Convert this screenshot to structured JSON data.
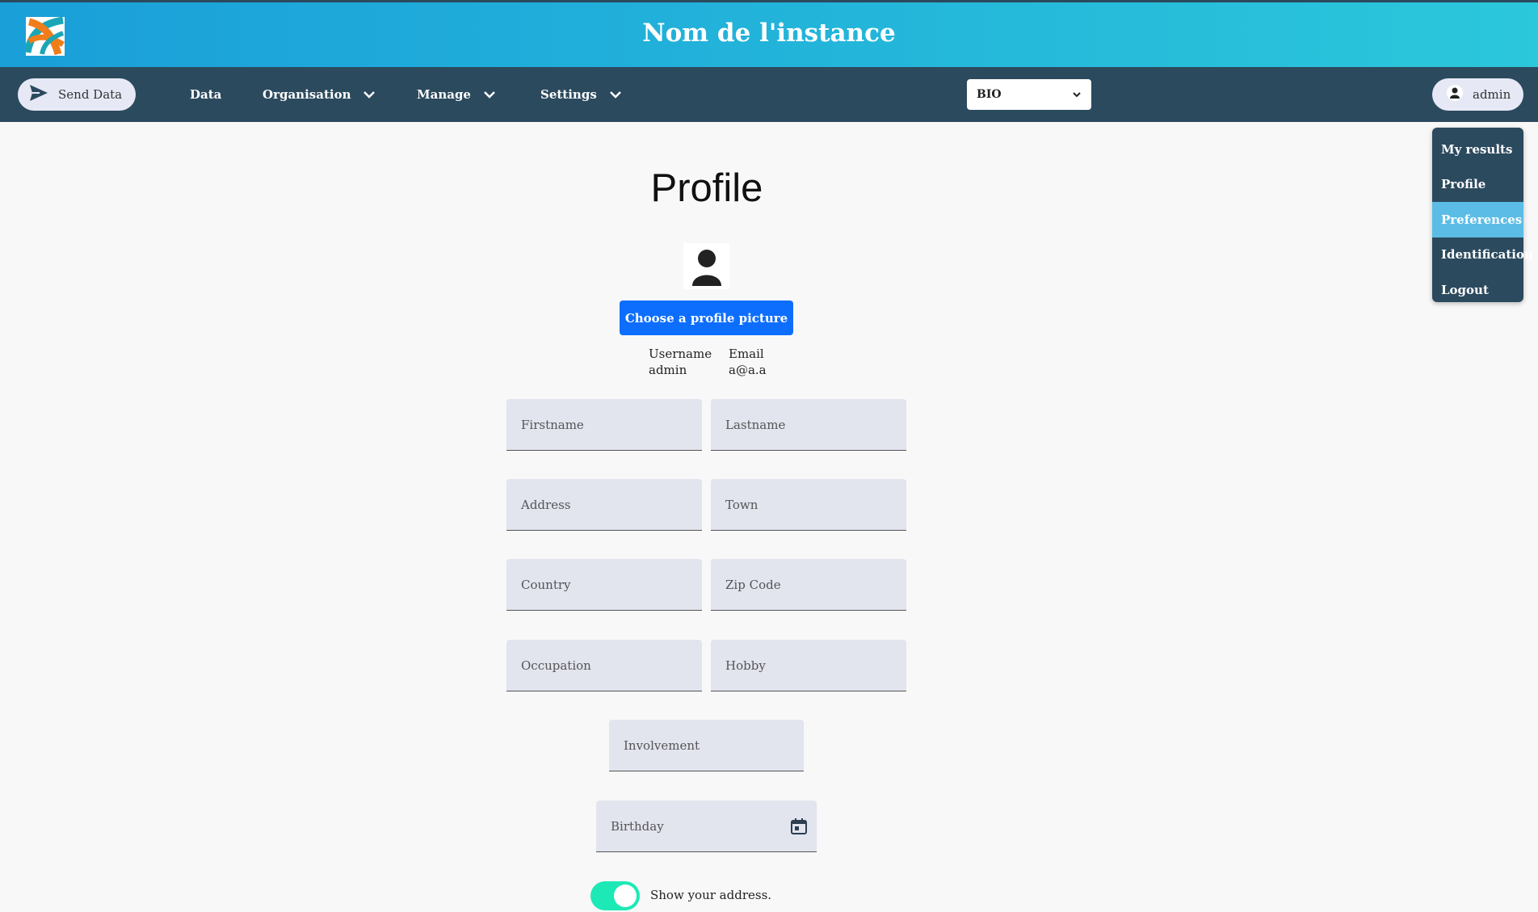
{
  "header": {
    "title": "Nom de l'instance",
    "logo_icon": "logo-icon"
  },
  "nav": {
    "send_label": "Send Data",
    "items": [
      {
        "label": "Data"
      },
      {
        "label": "Organisation"
      },
      {
        "label": "Manage"
      },
      {
        "label": "Settings"
      }
    ],
    "select_value": "BIO",
    "user_label": "admin"
  },
  "user_menu": {
    "items": [
      {
        "label": "My results"
      },
      {
        "label": "Profile"
      },
      {
        "label": "Preferences",
        "active": true
      },
      {
        "label": "Identification"
      },
      {
        "label": "Logout"
      }
    ]
  },
  "profile": {
    "title": "Profile",
    "choose_picture_label": "Choose a profile picture",
    "username_label": "Username",
    "username_value": "admin",
    "email_label": "Email",
    "email_value": "a@a.a",
    "fields": {
      "firstname": "Firstname",
      "lastname": "Lastname",
      "address": "Address",
      "town": "Town",
      "country": "Country",
      "zip": "Zip Code",
      "occupation": "Occupation",
      "hobby": "Hobby",
      "involvement": "Involvement",
      "birthday": "Birthday"
    },
    "show_address_label": "Show your address.",
    "show_address_on": true
  },
  "colors": {
    "navbar": "#2c4a5e",
    "accent_blue": "#0d6efd",
    "active_menu": "#5bbde6",
    "toggle_on": "#1de9b6"
  }
}
